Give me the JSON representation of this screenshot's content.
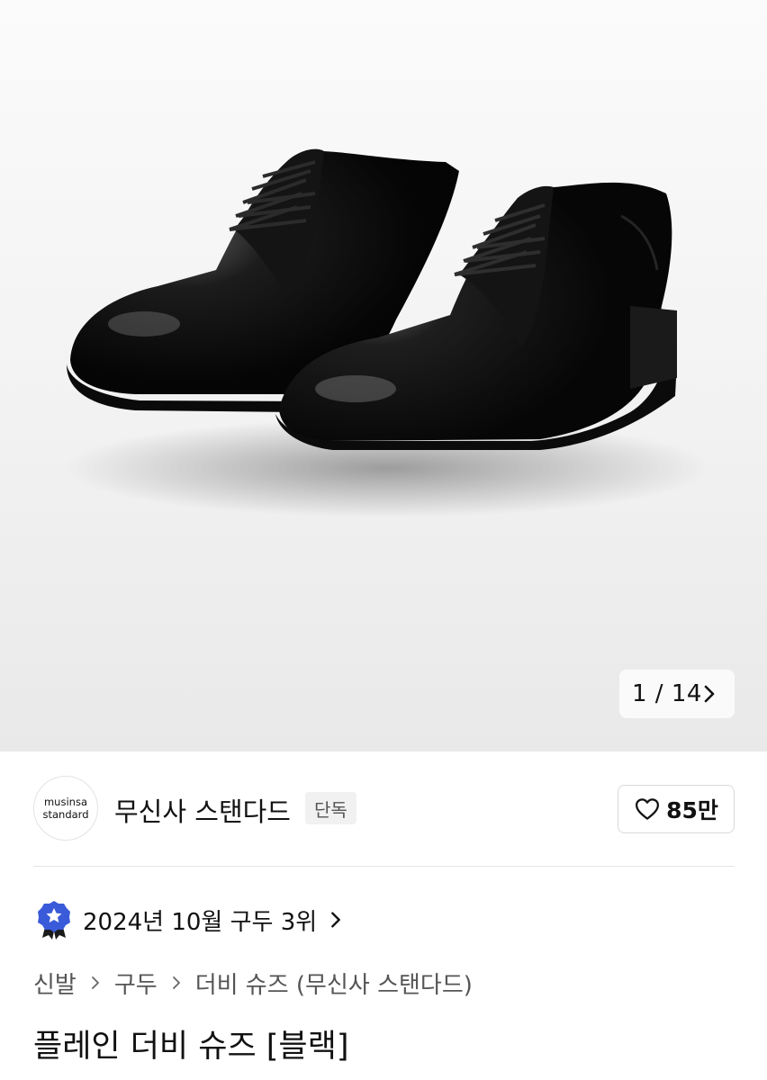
{
  "gallery": {
    "current": "1",
    "separator": "/",
    "total": "14",
    "counter_text": "1 / 14",
    "image_icon": "black-derby-shoes-photo"
  },
  "brand": {
    "logo_line1": "musinsa",
    "logo_line2": "standard",
    "name": "무신사 스탠다드",
    "badge": "단독",
    "like_count": "85만"
  },
  "ranking": {
    "text": "2024년 10월 구두 3위",
    "icon": "medal-star-icon",
    "accent": "#3a5bd9"
  },
  "breadcrumb": {
    "items": [
      "신발",
      "구두",
      "더비 슈즈 (무신사 스탠다드)"
    ]
  },
  "product": {
    "title": "플레인 더비 슈즈 [블랙]"
  }
}
